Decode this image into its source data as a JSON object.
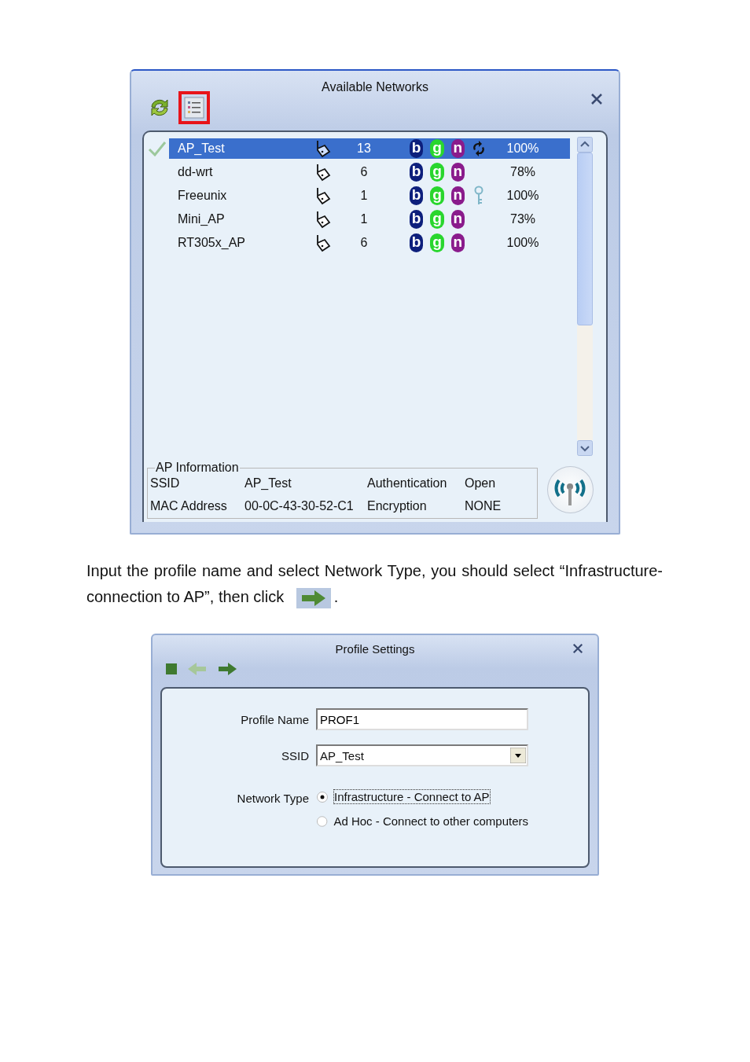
{
  "networks_dialog": {
    "title": "Available Networks",
    "toolbar": [
      {
        "kind": "refresh",
        "highlighted": false
      },
      {
        "kind": "list",
        "highlighted": true
      }
    ],
    "networks": [
      {
        "ssid": "AP_Test",
        "channel": "13",
        "signal": "100%",
        "selected": true,
        "connected": true,
        "kind": "wps",
        "modes": [
          {
            "label": "b",
            "color": "#0d1f7c"
          },
          {
            "label": "g",
            "color": "#29d62e"
          },
          {
            "label": "n",
            "color": "#8a1b8c"
          }
        ]
      },
      {
        "ssid": "dd-wrt",
        "channel": "6",
        "signal": "78%",
        "selected": false,
        "connected": false,
        "kind": "plain",
        "modes": [
          {
            "label": "b",
            "color": "#0d1f7c"
          },
          {
            "label": "g",
            "color": "#29d62e"
          },
          {
            "label": "n",
            "color": "#8a1b8c"
          }
        ]
      },
      {
        "ssid": "Freeunix",
        "channel": "1",
        "signal": "100%",
        "selected": false,
        "connected": false,
        "kind": "key",
        "modes": [
          {
            "label": "b",
            "color": "#0d1f7c"
          },
          {
            "label": "g",
            "color": "#29d62e"
          },
          {
            "label": "n",
            "color": "#8a1b8c"
          }
        ]
      },
      {
        "ssid": "Mini_AP",
        "channel": "1",
        "signal": "73%",
        "selected": false,
        "connected": false,
        "kind": "plain",
        "modes": [
          {
            "label": "b",
            "color": "#0d1f7c"
          },
          {
            "label": "g",
            "color": "#29d62e"
          },
          {
            "label": "n",
            "color": "#8a1b8c"
          }
        ]
      },
      {
        "ssid": "RT305x_AP",
        "channel": "6",
        "signal": "100%",
        "selected": false,
        "connected": false,
        "kind": "plain",
        "modes": [
          {
            "label": "b",
            "color": "#0d1f7c"
          },
          {
            "label": "g",
            "color": "#29d62e"
          },
          {
            "label": "n",
            "color": "#8a1b8c"
          }
        ]
      }
    ],
    "ap_information": {
      "title": "AP Information",
      "fields": [
        {
          "label": "SSID",
          "value": "AP_Test"
        },
        {
          "label": "Authentication",
          "value": "Open"
        },
        {
          "label": "MAC Address",
          "value": "00-0C-43-30-52-C1"
        },
        {
          "label": "Encryption",
          "value": "NONE"
        }
      ]
    }
  },
  "instruction": {
    "text": "Input the profile name and select Network Type, you should select “Infrastructure-connection to AP”, then click",
    "after_icon": "."
  },
  "profile_dialog": {
    "title": "Profile Settings",
    "toolbar": [
      {
        "kind": "stop",
        "disabled": false
      },
      {
        "kind": "back",
        "disabled": true
      },
      {
        "kind": "forward",
        "disabled": false
      }
    ],
    "profile_name": {
      "label": "Profile Name",
      "value": "PROF1"
    },
    "ssid": {
      "label": "SSID",
      "value": "AP_Test"
    },
    "network_type": {
      "label": "Network Type",
      "options": [
        {
          "label": "Infrastructure - Connect to AP",
          "selected": true
        },
        {
          "label": "Ad Hoc - Connect to other computers",
          "selected": false
        }
      ]
    }
  }
}
